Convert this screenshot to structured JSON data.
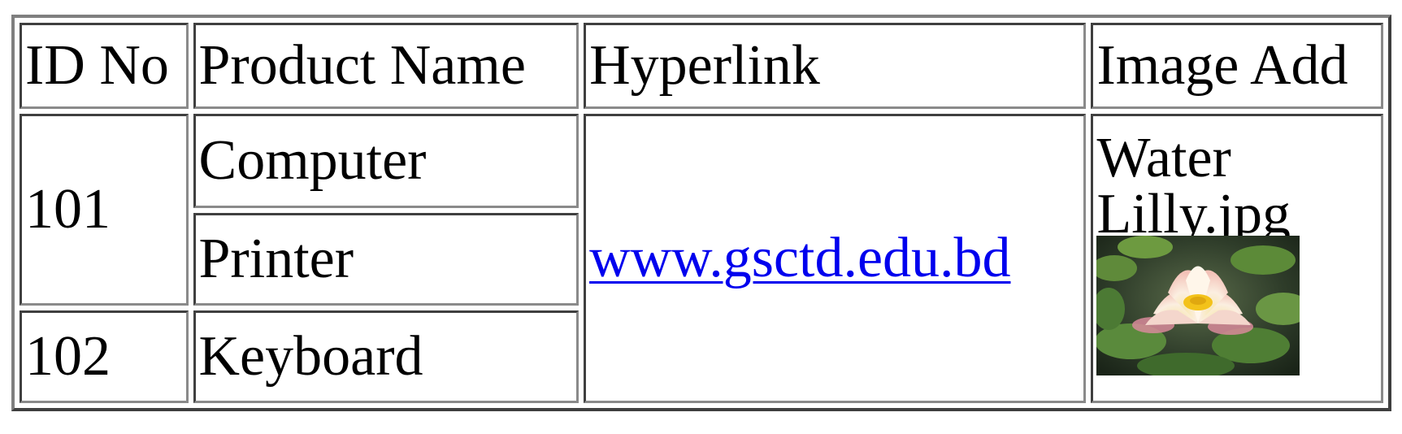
{
  "table": {
    "headers": {
      "id": "ID No",
      "name": "Product Name",
      "link": "Hyperlink",
      "image": "Image Add"
    },
    "rows": [
      {
        "id": "101",
        "products": [
          "Computer",
          "Printer"
        ]
      },
      {
        "id": "102",
        "products": [
          "Keyboard"
        ]
      }
    ],
    "hyperlink": "www.gsctd.edu.bd",
    "image_file_name": "Water Lilly.jpg",
    "image_subject": "water-lily-photo"
  },
  "colors": {
    "link": "#0000ee",
    "border_dark": "#3f3f3f",
    "border_light": "#7f7f7f"
  }
}
